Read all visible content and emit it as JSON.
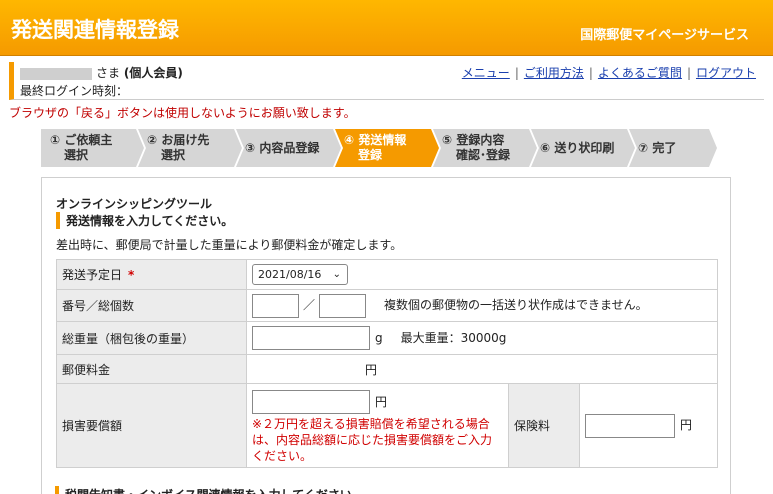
{
  "header": {
    "title": "発送関連情報登録",
    "service": "国際郵便マイページサービス"
  },
  "user": {
    "name_suffix": "さま",
    "member_type": "(個人会員)",
    "last_login_label": "最終ログイン時刻："
  },
  "top_links": [
    "メニュー",
    "ご利用方法",
    "よくあるご質問",
    "ログアウト"
  ],
  "warning": "ブラウザの「戻る」ボタンは使用しないようにお願い致します。",
  "steps": [
    {
      "line1": "① ご依頼主",
      "line2": "選択"
    },
    {
      "line1": "② お届け先",
      "line2": "選択"
    },
    {
      "line1": "③ 内容品登録",
      "line2": ""
    },
    {
      "line1": "④ 発送情報",
      "line2": "登録"
    },
    {
      "line1": "⑤ 登録内容",
      "line2": "確認･登録"
    },
    {
      "line1": "⑥ 送り状印刷",
      "line2": ""
    },
    {
      "line1": "⑦ 完了",
      "line2": ""
    }
  ],
  "active_step_index": 3,
  "panel": {
    "tool_title": "オンラインシッピングツール",
    "section_head": "発送情報を入力してください。",
    "section_note": "差出時に、郵便局で計量した重量により郵便料金が確定します。"
  },
  "form": {
    "ship_date_label": "発送予定日",
    "required_mark": "*",
    "ship_date_value": "2021/08/16",
    "number_label": "番号／総個数",
    "number_slash": "／",
    "number_msg": "複数個の郵便物の一括送り状作成はできません。",
    "weight_label": "総重量（梱包後の重量）",
    "weight_unit": "g",
    "weight_max": "最大重量：30000g",
    "postage_label": "郵便料金",
    "postage_unit": "円",
    "damage_label": "損害要償額",
    "damage_unit": "円",
    "damage_note": "※２万円を超える損害賠償を希望される場合は、内容品総額に応じた損害要償額をご入力ください。",
    "insurance_label": "保険料",
    "insurance_unit": "円"
  },
  "next_section": "税関告知書・インボイス関連情報を入力してください"
}
